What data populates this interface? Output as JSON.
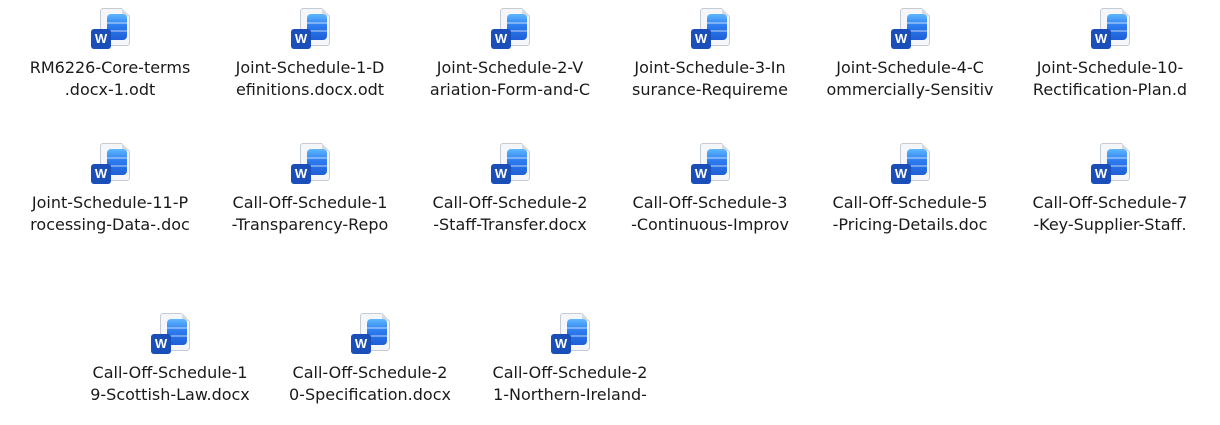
{
  "files": [
    {
      "line1": "RM6226-Core-terms",
      "line2": ".docx-1.odt",
      "icon": "word-document-icon",
      "badge": "W"
    },
    {
      "line1": "Joint-Schedule-1-D",
      "line2": "efinitions.docx.odt",
      "icon": "word-document-icon",
      "badge": "W"
    },
    {
      "line1": "Joint-Schedule-2-V",
      "line2": "ariation-Form-and-C",
      "icon": "word-document-icon",
      "badge": "W"
    },
    {
      "line1": "Joint-Schedule-3-In",
      "line2": "surance-Requireme",
      "icon": "word-document-icon",
      "badge": "W"
    },
    {
      "line1": "Joint-Schedule-4-C",
      "line2": "ommercially-Sensitiv",
      "icon": "word-document-icon",
      "badge": "W"
    },
    {
      "line1": "Joint-Schedule-10-",
      "line2": "Rectification-Plan.d",
      "icon": "word-document-icon",
      "badge": "W"
    },
    {
      "line1": "Joint-Schedule-11-P",
      "line2": "rocessing-Data-.doc",
      "icon": "word-document-icon",
      "badge": "W"
    },
    {
      "line1": "Call-Off-Schedule-1",
      "line2": "-Transparency-Repo",
      "icon": "word-document-icon",
      "badge": "W"
    },
    {
      "line1": "Call-Off-Schedule-2",
      "line2": "-Staff-Transfer.docx",
      "icon": "word-document-icon",
      "badge": "W"
    },
    {
      "line1": "Call-Off-Schedule-3",
      "line2": "-Continuous-Improv",
      "icon": "word-document-icon",
      "badge": "W"
    },
    {
      "line1": "Call-Off-Schedule-5",
      "line2": "-Pricing-Details.doc",
      "icon": "word-document-icon",
      "badge": "W"
    },
    {
      "line1": "Call-Off-Schedule-7",
      "line2": "-Key-Supplier-Staff.",
      "icon": "word-document-icon",
      "badge": "W"
    },
    {
      "line1": "Call-Off-Schedule-1",
      "line2": "9-Scottish-Law.docx",
      "icon": "word-document-icon",
      "badge": "W"
    },
    {
      "line1": "Call-Off-Schedule-2",
      "line2": "0-Specification.docx",
      "icon": "word-document-icon",
      "badge": "W"
    },
    {
      "line1": "Call-Off-Schedule-2",
      "line2": "1-Northern-Ireland-",
      "icon": "word-document-icon",
      "badge": "W"
    }
  ]
}
